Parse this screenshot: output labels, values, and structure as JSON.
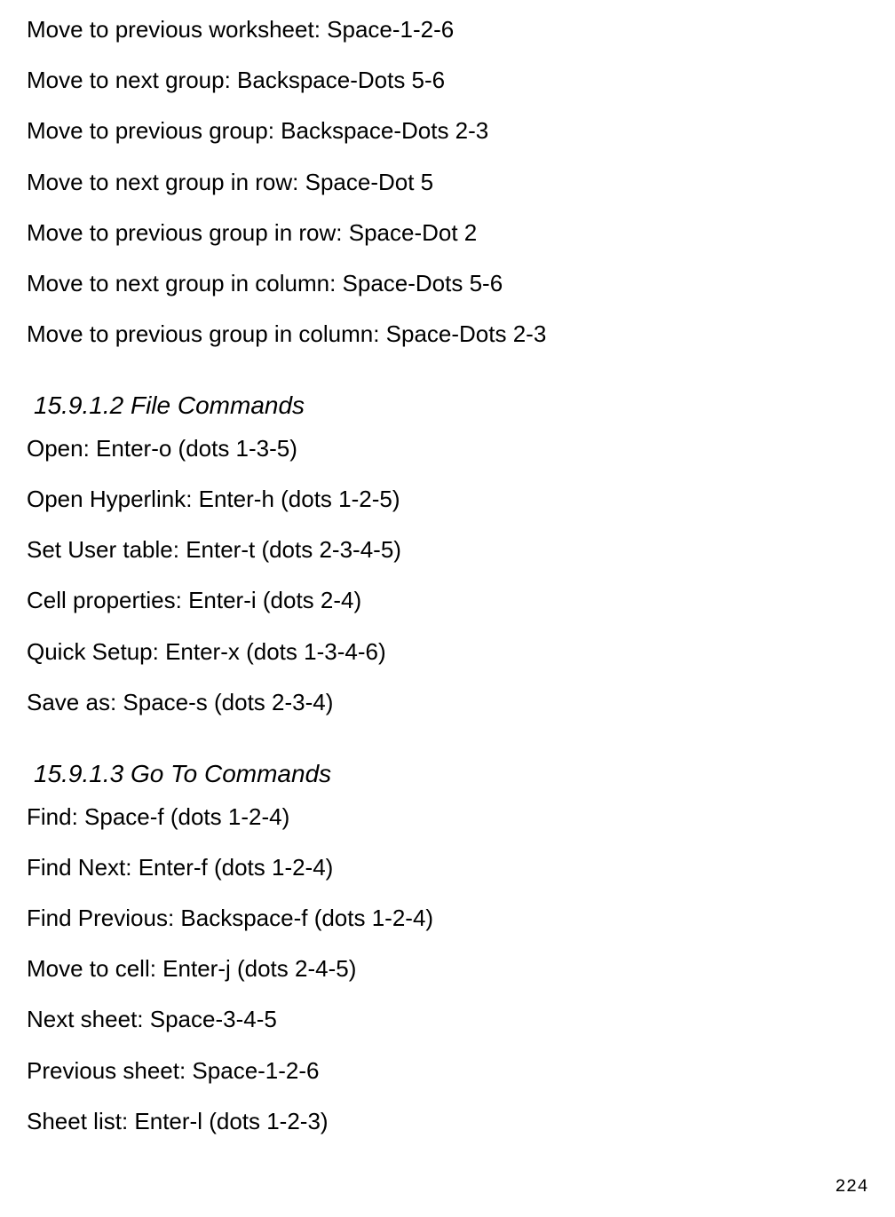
{
  "section1": {
    "lines": [
      "Move to previous worksheet: Space-1-2-6",
      "Move to next group: Backspace-Dots 5-6",
      "Move to previous group: Backspace-Dots 2-3",
      "Move to next group in row: Space-Dot 5",
      "Move to previous group in row: Space-Dot 2",
      "Move to next group in column: Space-Dots 5-6",
      "Move to previous group in column: Space-Dots 2-3"
    ]
  },
  "section2": {
    "heading": "15.9.1.2 File Commands",
    "lines": [
      "Open: Enter-o (dots 1-3-5)",
      "Open Hyperlink: Enter-h (dots 1-2-5)",
      "Set User table: Enter-t (dots 2-3-4-5)",
      "Cell properties: Enter-i (dots 2-4)",
      "Quick Setup: Enter-x (dots 1-3-4-6)",
      "Save as: Space-s (dots 2-3-4)"
    ]
  },
  "section3": {
    "heading": "15.9.1.3 Go To Commands",
    "lines": [
      "Find: Space-f (dots 1-2-4)",
      "Find Next: Enter-f (dots 1-2-4)",
      "Find Previous: Backspace-f (dots 1-2-4)",
      "Move to cell: Enter-j (dots 2-4-5)",
      "Next sheet: Space-3-4-5",
      "Previous sheet: Space-1-2-6",
      "Sheet list: Enter-l (dots 1-2-3)"
    ]
  },
  "pageNumber": "224"
}
